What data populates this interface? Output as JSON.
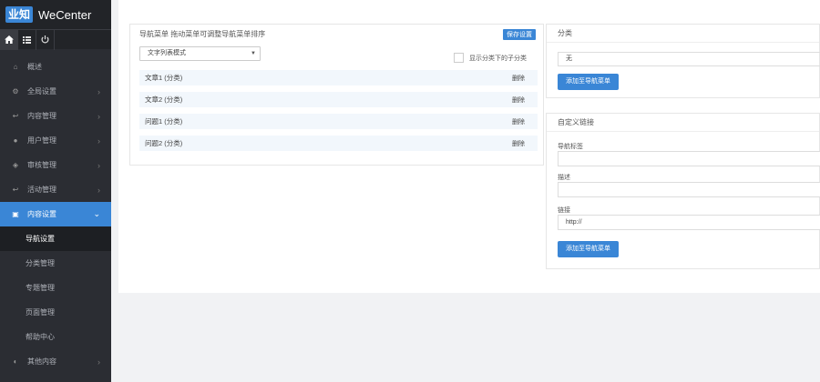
{
  "brand": {
    "logo": "业知",
    "name": "WeCenter"
  },
  "sidebar": {
    "items": [
      {
        "label": "概述",
        "icon": "home-icon"
      },
      {
        "label": "全局设置",
        "icon": "gear-icon"
      },
      {
        "label": "内容管理",
        "icon": "reply-icon"
      },
      {
        "label": "用户管理",
        "icon": "user-icon"
      },
      {
        "label": "审核管理",
        "icon": "shield-icon"
      },
      {
        "label": "活动管理",
        "icon": "reply-icon"
      },
      {
        "label": "内容设置",
        "icon": "content-icon"
      },
      {
        "label": "其他内容",
        "icon": "other-icon"
      }
    ],
    "sub_items": [
      "导航设置",
      "分类管理",
      "专题管理",
      "页面管理",
      "帮助中心"
    ]
  },
  "nav_panel": {
    "title": "导航菜单 拖动菜单可调整导航菜单排序",
    "save_label": "保存设置",
    "style_select": "文字列表模式",
    "show_sub_label": "显示分类下的子分类",
    "delete_label": "删除",
    "rows": [
      "文章1 (分类)",
      "文章2 (分类)",
      "问题1 (分类)",
      "问题2 (分类)"
    ]
  },
  "category_panel": {
    "title": "分类",
    "value": "无",
    "add_label": "添加至导航菜单"
  },
  "custom_panel": {
    "title": "自定义链接",
    "name_label": "导航标签",
    "desc_label": "描述",
    "link_label": "链接",
    "link_value": "http://",
    "add_label": "添加至导航菜单"
  },
  "colors": {
    "accent": "#3a86d6",
    "sidebar_bg": "#2b2d33"
  }
}
